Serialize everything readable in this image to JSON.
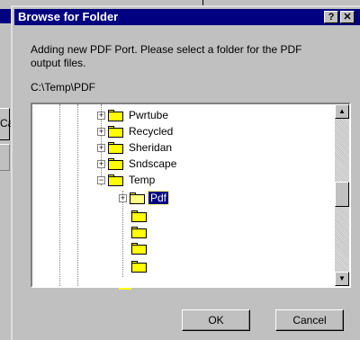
{
  "dialog": {
    "title": "Browse for Folder",
    "help_label": "?",
    "close_label": "✕",
    "message": "Adding new PDF Port. Please select a folder for the PDF output files.",
    "current_path": "C:\\Temp\\PDF",
    "ok_label": "OK",
    "cancel_label": "Cancel"
  },
  "background": {
    "button_fragment": "Ca"
  },
  "tree": {
    "items": [
      {
        "label": "Pwrtube",
        "expander": "+"
      },
      {
        "label": "Recycled",
        "expander": "+"
      },
      {
        "label": "Sheridan",
        "expander": "+"
      },
      {
        "label": "Sndscape",
        "expander": "+"
      },
      {
        "label": "Temp",
        "expander": "−",
        "expanded": true
      },
      {
        "label": "Pdf",
        "expander": "+",
        "selected": true
      },
      {
        "label": ""
      },
      {
        "label": ""
      },
      {
        "label": ""
      },
      {
        "label": ""
      }
    ],
    "scroll_up": "▲",
    "scroll_down": "▼"
  }
}
